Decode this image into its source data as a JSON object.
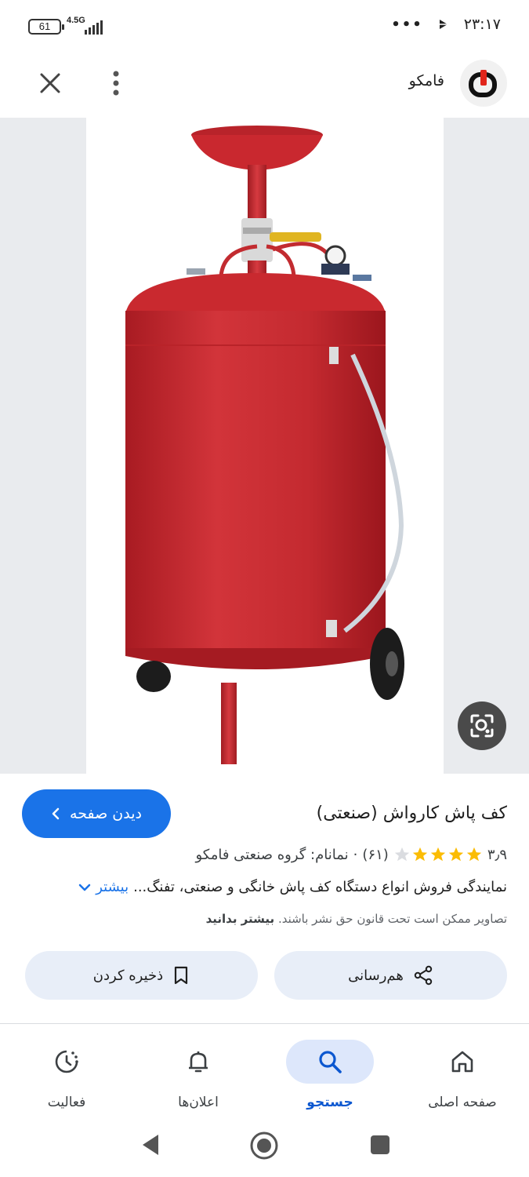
{
  "status_bar": {
    "battery": "61",
    "network": "4.5G",
    "time": "۲۳:۱۷",
    "more_dots": "•••"
  },
  "header": {
    "site_name": "فامکو"
  },
  "result": {
    "visit_button_label": "دیدن صفحه",
    "title": "کف پاش کارواش (صنعتی)",
    "rating_value": "۳٫۹",
    "rating_stars": 3.9,
    "review_count": "(۶۱)",
    "separator": "·",
    "seller": "نمانام: گروه صنعتی فامکو",
    "description": "نمایندگی فروش انواع دستگاه کف پاش خانگی و صنعتی، تفنگ...",
    "more_label": "بیشتر",
    "copyright_text": "تصاویر ممکن است تحت قانون حق نشر باشند.",
    "learn_more": "بیشتر بدانید",
    "share_label": "هم‌رسانی",
    "save_label": "ذخیره کردن"
  },
  "bottom_nav": {
    "items": [
      {
        "label": "صفحه اصلی",
        "icon": "home-icon"
      },
      {
        "label": "جستجو",
        "icon": "search-icon",
        "active": true
      },
      {
        "label": "اعلان‌ها",
        "icon": "bell-icon"
      },
      {
        "label": "فعالیت",
        "icon": "activity-icon"
      }
    ]
  },
  "colors": {
    "accent": "#1a73e8",
    "tank_red": "#c8252b",
    "chip_bg": "#e8eef8",
    "image_bg": "#e9ebee"
  }
}
